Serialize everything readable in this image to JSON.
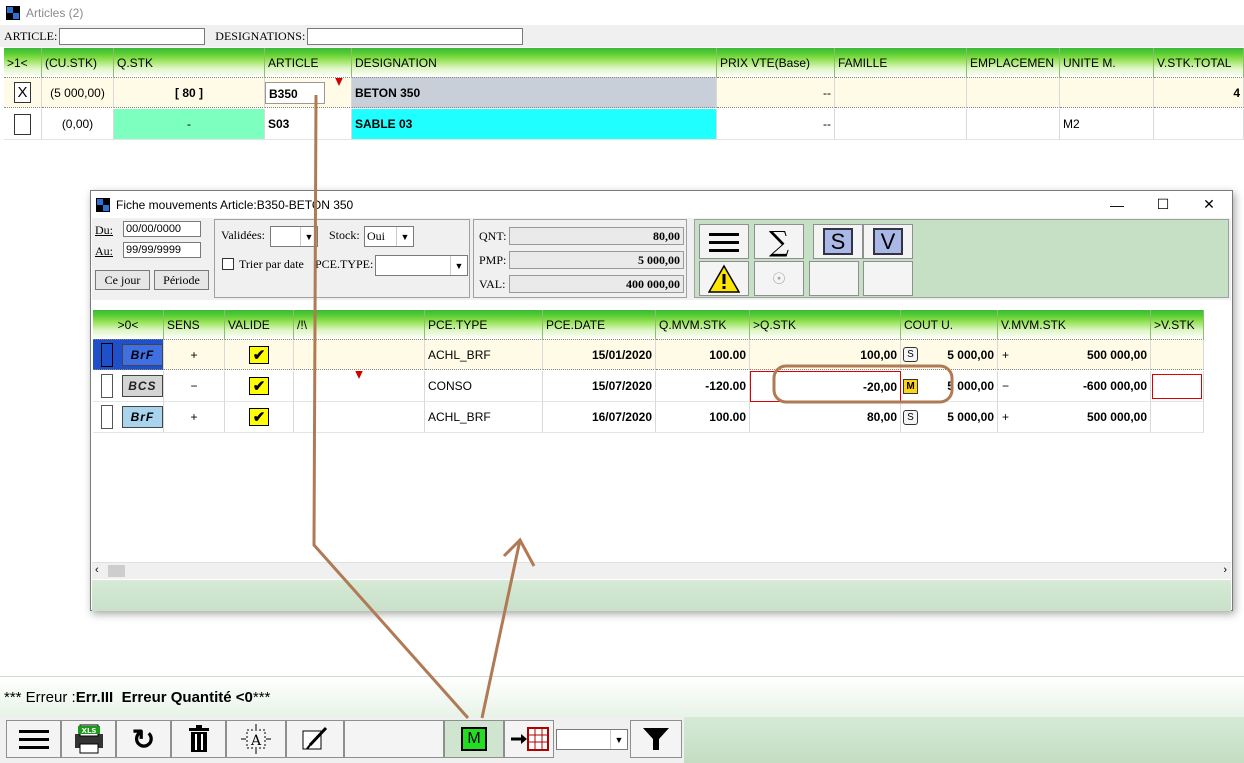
{
  "window": {
    "title": "Articles (2)"
  },
  "filters": {
    "article_label": "ARTICLE:",
    "article_value": "",
    "designations_label": "DESIGNATIONS:",
    "designations_value": ""
  },
  "grid": {
    "columns": [
      ">1<",
      "(CU.STK)",
      "Q.STK",
      "ARTICLE",
      "DESIGNATION",
      "PRIX VTE(Base)",
      "FAMILLE",
      "EMPLACEMEN",
      "UNITE M.",
      "V.STK.TOTAL"
    ],
    "rows": [
      {
        "check": "X",
        "cu_stk": "(5 000,00)",
        "q_stk": "[ 80 ]",
        "article": "B350",
        "designation": "BETON 350",
        "prix": "--",
        "famille": "",
        "emplacement": "",
        "unite": "",
        "vstk": "4"
      },
      {
        "check": "",
        "cu_stk": "(0,00)",
        "q_stk": "-",
        "article": "S03",
        "designation": "SABLE 03",
        "prix": "--",
        "famille": "",
        "emplacement": "",
        "unite": "M2",
        "vstk": ""
      }
    ]
  },
  "colors": {
    "designation_row1": "#c9cfd8",
    "designation_row2": "#1fffff",
    "qstk_row2": "#7cffbf",
    "header_green": "#57cc33",
    "annotation": "#b07a55"
  },
  "dialog": {
    "title": "Fiche mouvements Article:B350-BETON 350",
    "du_label": "Du:",
    "du_value": "00/00/0000",
    "au_label": "Au:",
    "au_value": "99/99/9999",
    "ce_jour": "Ce jour",
    "periode": "Période",
    "validees_label": "Validées:",
    "validees_value": "",
    "stock_label": "Stock:",
    "stock_value": "Oui",
    "trier_label": "Trier par date",
    "pce_type_label": "PCE.TYPE:",
    "pce_type_value": "",
    "qnt_label": "QNT:",
    "qnt_value": "80,00",
    "pmp_label": "PMP:",
    "pmp_value": "5 000,00",
    "val_label": "VAL:",
    "val_value": "400 000,00",
    "columns": [
      ">0<",
      "SENS",
      "VALIDE",
      "/!\\",
      "PCE.TYPE",
      "PCE.DATE",
      "Q.MVM.STK",
      ">Q.STK",
      "COUT U.",
      "V.MVM.STK",
      ">V.STK"
    ],
    "rows": [
      {
        "badge": "BrF",
        "sens": "+",
        "pce_type": "ACHL_BRF",
        "pce_date": "15/01/2020",
        "q_mvm": "100.00",
        "q_stk": "100,00",
        "cout_flag": "S",
        "cout": "5 000,00",
        "v_sign": "+",
        "v_mvm": "500 000,00"
      },
      {
        "badge": "BCS",
        "sens": "−",
        "pce_type": "CONSO",
        "pce_date": "15/07/2020",
        "q_mvm": "-120.00",
        "q_stk": "-20,00",
        "cout_flag": "M",
        "cout": "5 000,00",
        "v_sign": "−",
        "v_mvm": "-600 000,00"
      },
      {
        "badge": "BrF",
        "sens": "+",
        "pce_type": "ACHL_BRF",
        "pce_date": "16/07/2020",
        "q_mvm": "100.00",
        "q_stk": "80,00",
        "cout_flag": "S",
        "cout": "5 000,00",
        "v_sign": "+",
        "v_mvm": "500 000,00"
      }
    ],
    "buttons": {
      "s_label": "S",
      "v_label": "V"
    }
  },
  "error": {
    "prefix": "*** Erreur  :",
    "code": "Err.III",
    "message": "  Erreur Quantité <0",
    "suffix": "***"
  },
  "toolbar": {
    "m_label": "M",
    "xls_label": "XLS",
    "combo_value": ""
  }
}
